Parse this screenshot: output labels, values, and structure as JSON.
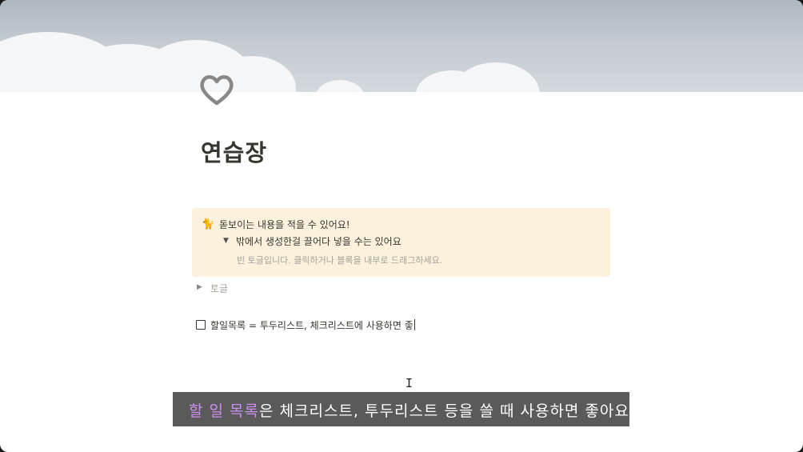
{
  "page": {
    "icon": "heart-icon",
    "title": "연습장"
  },
  "callout": {
    "emoji": "cat-emoji-icon",
    "emoji_glyph": "🐈",
    "text": "돋보이는 내용을 적을 수 있어요!",
    "nested_toggle": {
      "label": "밖에서 생성한걸 끌어다 넣을 수는 있어요",
      "placeholder": "빈 토글입니다. 클릭하거나 블록을 내부로 드래그하세요."
    }
  },
  "toggle": {
    "label": "토글"
  },
  "todo": {
    "checked": false,
    "text": "할일목록 = 투두리스트, 체크리스트에 사용하면 좋"
  },
  "subtitle": {
    "highlight": "할 일 목록",
    "rest": "은 체크리스트, 투두리스트 등을 쓸 때 사용하면 좋아요",
    "highlight_color": "#cc8df0"
  },
  "colors": {
    "callout_background": "#fbf1dc",
    "text_primary": "#37352f",
    "text_placeholder": "#a6a39c"
  }
}
